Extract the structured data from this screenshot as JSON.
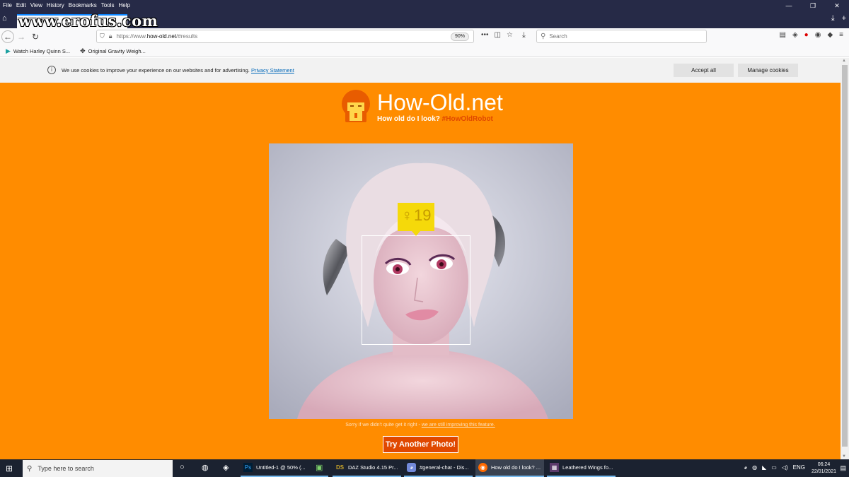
{
  "browser": {
    "menu": [
      "File",
      "Edit",
      "View",
      "History",
      "Bookmarks",
      "Tools",
      "Help"
    ],
    "window_controls": [
      "—",
      "❐",
      "✕"
    ],
    "watermark": "www.erofus.com",
    "url": {
      "prefix": "https://www.",
      "domain": "how-old.net",
      "suffix": "/#results"
    },
    "zoom": "90%",
    "search_placeholder": "Search",
    "bookmarks": [
      {
        "label": "Watch Harley Quinn S...",
        "icon": "play-circle-icon"
      },
      {
        "label": "Original Gravity Weigh...",
        "icon": "bird-icon"
      }
    ]
  },
  "cookie_banner": {
    "text": "We use cookies to improve your experience on our websites and for advertising.",
    "link": "Privacy Statement",
    "accept": "Accept all",
    "manage": "Manage cookies"
  },
  "site": {
    "brand": "How-Old.net",
    "tagline": "How old do I look?",
    "hashtag": "#HowOldRobot",
    "result": {
      "gender": "female",
      "age": "19"
    },
    "sorry_text": "Sorry if we didn't quite get it right -",
    "sorry_link": "we are still improving this feature.",
    "try_again": "Try Another Photo!"
  },
  "taskbar": {
    "search_placeholder": "Type here to search",
    "apps": [
      {
        "label": "Untitled-1 @ 50% (...",
        "icon": "Ps"
      },
      {
        "label": "DAZ Studio 4.15 Pr...",
        "icon": "DS"
      },
      {
        "label": "#general-chat - Dis...",
        "icon": "discord"
      },
      {
        "label": "How old do I look? ...",
        "icon": "firefox"
      },
      {
        "label": "Leathered Wings fo...",
        "icon": "photo"
      }
    ],
    "lang": "ENG",
    "time": "06:24",
    "date": "22/01/2021"
  },
  "colors": {
    "page_bg": "#ff8c00",
    "button": "#e04800",
    "badge": "#f5d90a"
  }
}
